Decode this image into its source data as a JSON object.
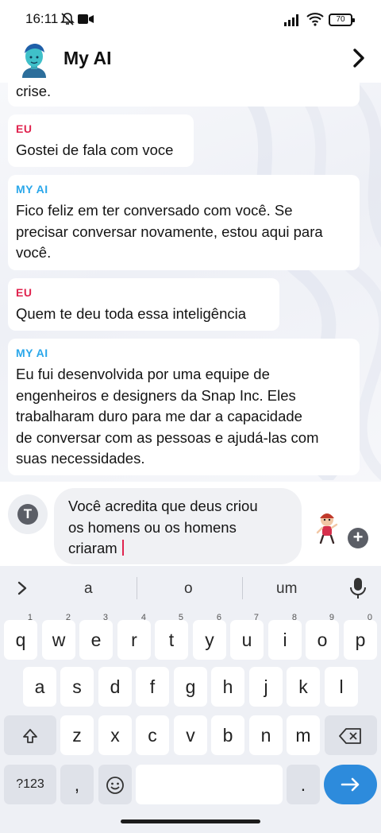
{
  "status_bar": {
    "time": "16:11",
    "battery": "70"
  },
  "header": {
    "title": "My AI"
  },
  "chat": {
    "partial_text": "crise.",
    "messages": [
      {
        "sender": "EU",
        "text": "Gostei de fala com voce"
      },
      {
        "sender": "MY AI",
        "lines": [
          "Fico feliz em ter conversado com você. Se",
          "precisar conversar novamente, estou aqui para",
          "você."
        ]
      },
      {
        "sender": "EU",
        "text": "Quem te deu toda essa inteligência"
      },
      {
        "sender": "MY AI",
        "lines": [
          "Eu fui desenvolvida por uma equipe de",
          "engenheiros e designers da Snap Inc. Eles",
          "trabalharam duro para me dar a capacidade",
          "de conversar com as pessoas e ajudá-las com",
          "suas necessidades."
        ]
      }
    ]
  },
  "input": {
    "lines": [
      "Você acredita que deus criou",
      "os homens ou os homens",
      "criaram"
    ]
  },
  "keyboard": {
    "suggestions": [
      "a",
      "o",
      "um"
    ],
    "row1": [
      {
        "k": "q",
        "h": "1"
      },
      {
        "k": "w",
        "h": "2"
      },
      {
        "k": "e",
        "h": "3"
      },
      {
        "k": "r",
        "h": "4"
      },
      {
        "k": "t",
        "h": "5"
      },
      {
        "k": "y",
        "h": "6"
      },
      {
        "k": "u",
        "h": "7"
      },
      {
        "k": "i",
        "h": "8"
      },
      {
        "k": "o",
        "h": "9"
      },
      {
        "k": "p",
        "h": "0"
      }
    ],
    "row2": [
      "a",
      "s",
      "d",
      "f",
      "g",
      "h",
      "j",
      "k",
      "l"
    ],
    "row3": [
      "z",
      "x",
      "c",
      "v",
      "b",
      "n",
      "m"
    ],
    "symbols_label": "?123",
    "comma": ",",
    "period": ".",
    "icons": [
      "chevron-right-icon",
      "microphone-icon",
      "shift-icon",
      "backspace-icon",
      "emoji-icon",
      "arrow-right-icon"
    ]
  },
  "colors": {
    "eu": "#e0234e",
    "my_ai": "#2aa7ea",
    "enter_key": "#2d8bdc"
  }
}
